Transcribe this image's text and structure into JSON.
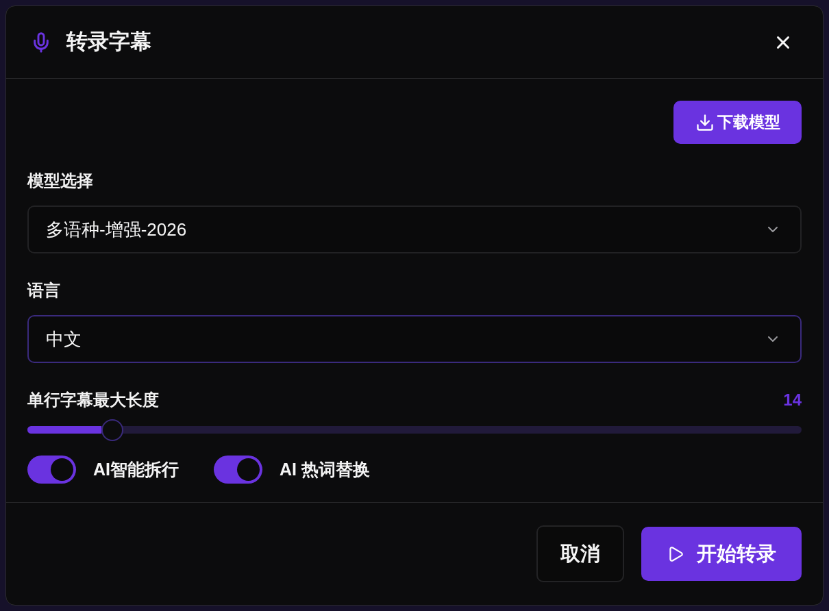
{
  "dialog": {
    "title": "转录字幕"
  },
  "download_button": {
    "label": "下载模型"
  },
  "fields": [
    {
      "kind": "select",
      "label": "模型选择",
      "value": "多语种-增强-2026",
      "focused": false
    },
    {
      "kind": "select",
      "label": "语言",
      "value": "中文",
      "focused": true
    }
  ],
  "slider": {
    "label": "单行字幕最大长度",
    "reading": "14",
    "level": 0.11
  },
  "toggles": [
    {
      "label": "AI智能拆行",
      "on": true
    },
    {
      "label": "AI 热词替换",
      "on": true
    }
  ],
  "footer": {
    "buttons": [
      {
        "kind": "secondary",
        "label": "取消"
      },
      {
        "kind": "primary",
        "label": "开始转录"
      }
    ]
  }
}
